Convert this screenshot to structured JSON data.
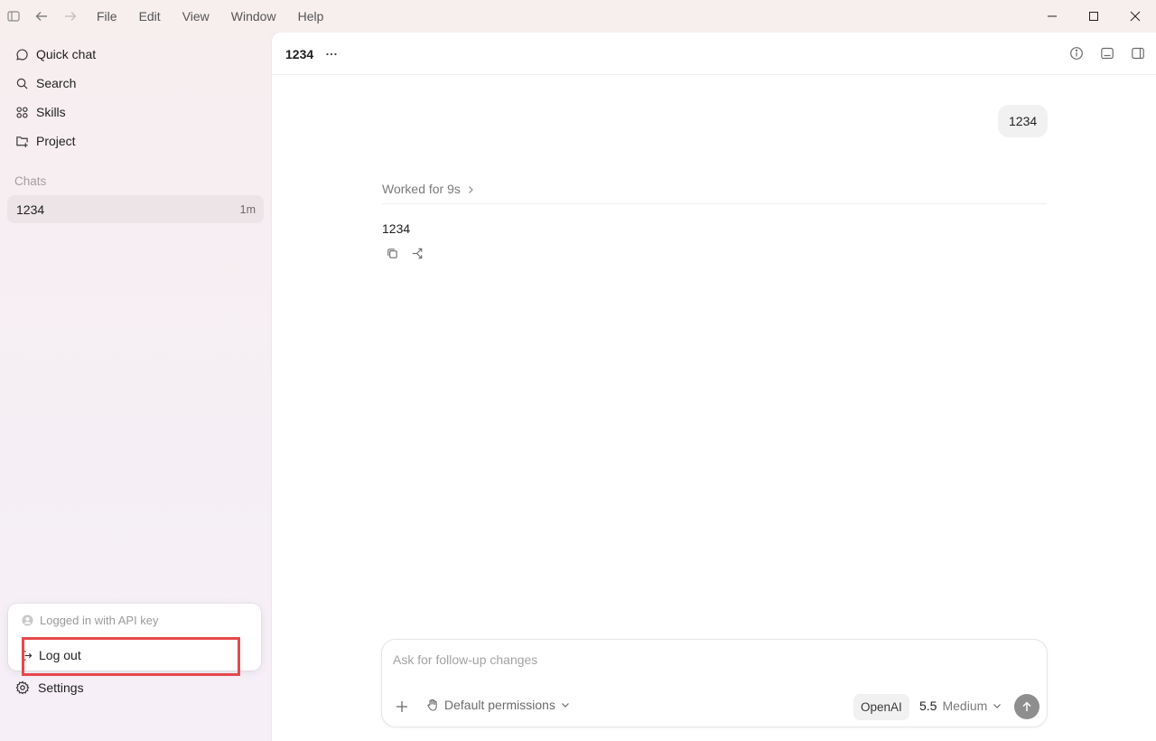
{
  "menu": [
    "File",
    "Edit",
    "View",
    "Window",
    "Help"
  ],
  "sidebar": {
    "nav": [
      {
        "label": "Quick chat",
        "icon": "chat-bubble-icon"
      },
      {
        "label": "Search",
        "icon": "search-icon"
      },
      {
        "label": "Skills",
        "icon": "grid-icon"
      },
      {
        "label": "Project",
        "icon": "folder-plus-icon"
      }
    ],
    "section_label": "Chats",
    "chats": [
      {
        "title": "1234",
        "time": "1m"
      }
    ]
  },
  "account_menu": {
    "status": "Logged in with API key",
    "logout": "Log out"
  },
  "settings_label": "Settings",
  "conversation": {
    "title": "1234",
    "user_message": "1234",
    "worked_label": "Worked for 9s",
    "reply": "1234"
  },
  "composer": {
    "placeholder": "Ask for follow-up changes",
    "permissions": "Default permissions",
    "provider": "OpenAI",
    "model_version": "5.5",
    "effort": "Medium"
  },
  "colors": {
    "highlight": "#e5484d",
    "send_button": "#8e8e8e",
    "chat_selected": "#ece4e6"
  }
}
